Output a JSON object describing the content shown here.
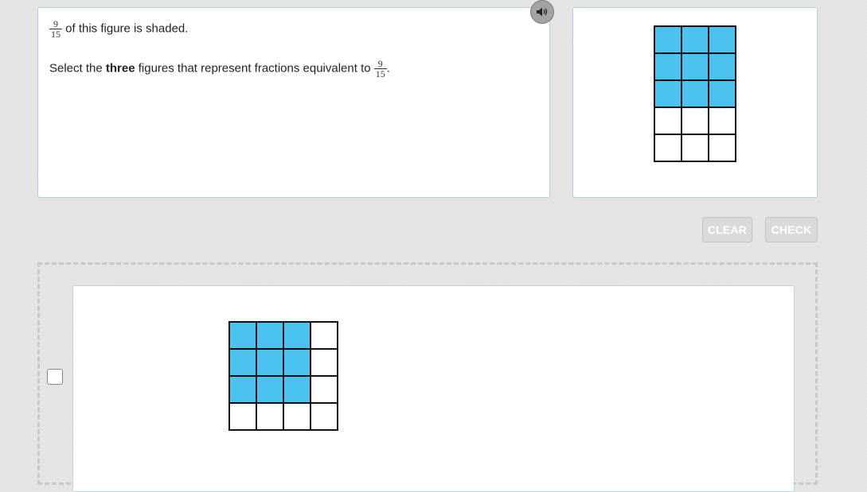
{
  "question": {
    "fraction": {
      "numerator": "9",
      "denominator": "15"
    },
    "line1_suffix": " of this figure is shaded.",
    "line2_prefix": "Select the ",
    "line2_bold": "three",
    "line2_middle": " figures that represent fractions equivalent to ",
    "line2_suffix": "."
  },
  "given_figure": {
    "rows": 5,
    "cols": 3,
    "shaded_cells": 9
  },
  "buttons": {
    "clear": "CLEAR",
    "check": "CHECK"
  },
  "options": [
    {
      "checked": false,
      "rows": 4,
      "cols": 4,
      "shaded_rows": 3,
      "shaded_cols": 3
    }
  ],
  "icons": {
    "audio": "speaker-icon"
  },
  "colors": {
    "shaded": "#4bc3ee",
    "panel_border": "#a9d3d8",
    "button": "#dadada"
  }
}
